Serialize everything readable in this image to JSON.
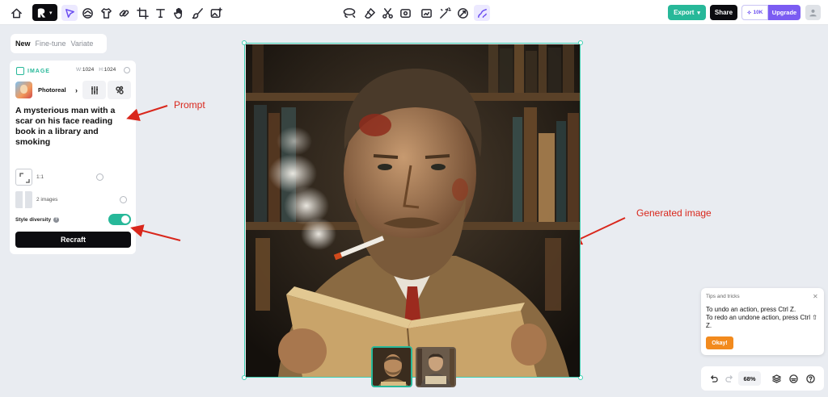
{
  "toolbar": {
    "tools": [
      "home-icon",
      "logo-menu",
      "select-icon",
      "mask-icon",
      "shirt-icon",
      "link-icon",
      "crop-icon",
      "text-icon",
      "hand-icon",
      "brush-icon",
      "image-add-icon"
    ],
    "center_tools": [
      "lasso-icon",
      "eraser-icon",
      "scissors-icon",
      "inpaint-icon",
      "upscale-icon",
      "magic-icon",
      "vectorize-icon"
    ],
    "export_label": "Export",
    "share_label": "Share",
    "credits": "10K",
    "upgrade_label": "Upgrade"
  },
  "panel": {
    "tabs": [
      "New",
      "Fine-tune",
      "Variate"
    ],
    "active_tab": "New",
    "section_label": "IMAGE",
    "width_label": "W:",
    "width": "1024",
    "height_label": "H:",
    "height": "1024",
    "style_name": "Photoreal",
    "prompt": "A mysterious man with a scar on his face reading book in a library and smoking",
    "aspect_ratio": "1:1",
    "image_count": "2 images",
    "style_diversity_label": "Style diversity",
    "style_diversity_on": true,
    "recraft_label": "Recraft"
  },
  "annotations": {
    "prompt": "Prompt",
    "generated": "Generated image"
  },
  "tips": {
    "title": "Tips and tricks",
    "line1": "To undo an action, press Ctrl Z.",
    "line2": "To redo an undone action, press Ctrl ⇧ Z.",
    "okay_label": "Okay!"
  },
  "bottom": {
    "zoom": "68%"
  },
  "colors": {
    "accent_green": "#27b899",
    "accent_purple": "#7b5cf2",
    "annotation_red": "#d9271c",
    "okay_orange": "#f28a1d"
  }
}
